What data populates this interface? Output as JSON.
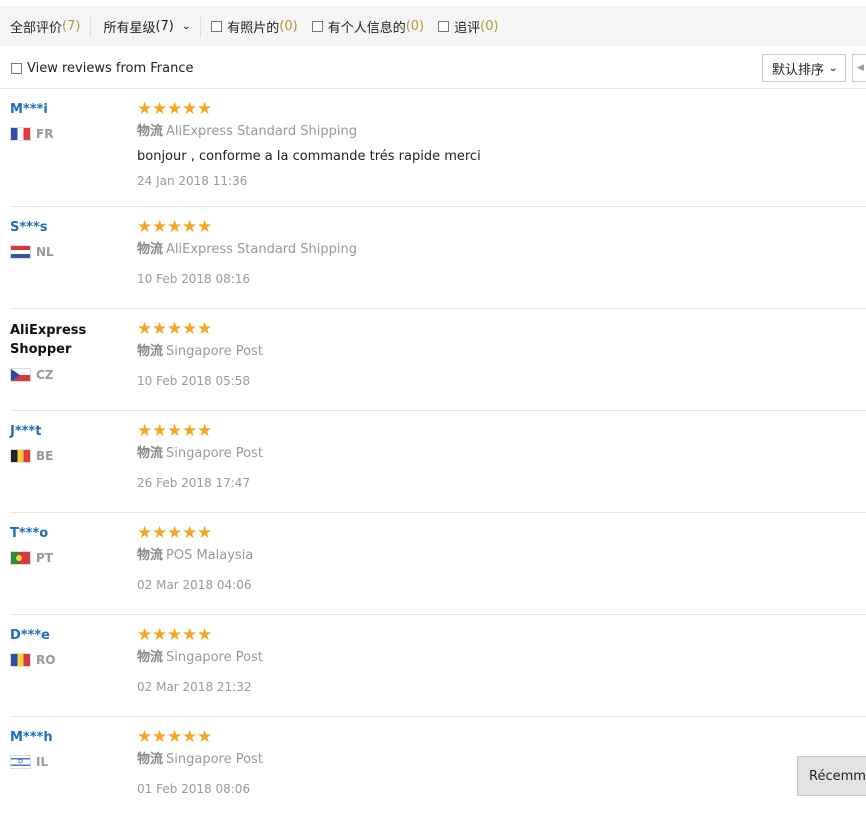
{
  "filters": {
    "all": {
      "label": "全部评价",
      "count": "(7)"
    },
    "star": {
      "label": "所有星级",
      "count": "(7)"
    },
    "photos": {
      "label": "有照片的",
      "count": "(0)"
    },
    "personal": {
      "label": "有个人信息的",
      "count": "(0)"
    },
    "additional": {
      "label": "追评",
      "count": "(0)"
    }
  },
  "country_filter": {
    "label": "View reviews from France"
  },
  "sort": {
    "label": "默认排序"
  },
  "shipping_label": "物流",
  "reviews": [
    {
      "user": "M***i",
      "country": "FR",
      "stars": 5,
      "shipping": "AliExpress Standard Shipping",
      "feedback": "bonjour , conforme a la commande trés rapide merci",
      "date": "24 Jan 2018 11:36"
    },
    {
      "user": "S***s",
      "country": "NL",
      "stars": 5,
      "shipping": "AliExpress Standard Shipping",
      "feedback": "",
      "date": "10 Feb 2018 08:16"
    },
    {
      "user": "AliExpress Shopper",
      "country": "CZ",
      "stars": 5,
      "shipping": "Singapore Post",
      "feedback": "",
      "date": "10 Feb 2018 05:58"
    },
    {
      "user": "J***t",
      "country": "BE",
      "stars": 5,
      "shipping": "Singapore Post",
      "feedback": "",
      "date": "26 Feb 2018 17:47"
    },
    {
      "user": "T***o",
      "country": "PT",
      "stars": 5,
      "shipping": "POS Malaysia",
      "feedback": "",
      "date": "02 Mar 2018 04:06"
    },
    {
      "user": "D***e",
      "country": "RO",
      "stars": 5,
      "shipping": "Singapore Post",
      "feedback": "",
      "date": "02 Mar 2018 21:32"
    },
    {
      "user": "M***h",
      "country": "IL",
      "stars": 5,
      "shipping": "Singapore Post",
      "feedback": "",
      "date": "01 Feb 2018 08:06"
    }
  ],
  "floating_button": {
    "label": "Récemm"
  },
  "colors": {
    "star": "#f5a623",
    "username_link": "#1a6cbd",
    "count": "#b09a3b"
  }
}
